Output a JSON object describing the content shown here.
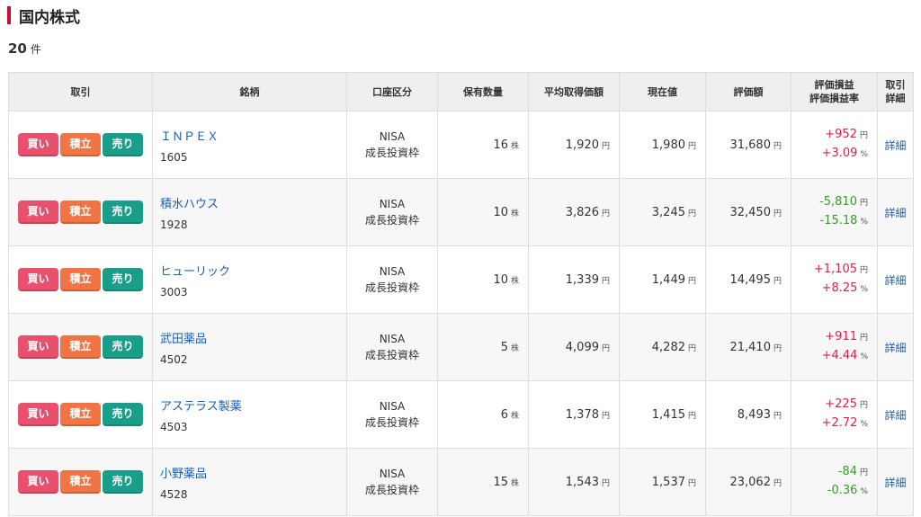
{
  "section": {
    "title": "国内株式"
  },
  "summary": {
    "count": "20",
    "unit": "件"
  },
  "headers": {
    "trade": "取引",
    "stock": "銘柄",
    "account": "口座区分",
    "quantity": "保有数量",
    "avg_cost": "平均取得価額",
    "price": "現在値",
    "value": "評価額",
    "pl_line1": "評価損益",
    "pl_line2": "評価損益率",
    "detail_line1": "取引",
    "detail_line2": "詳細"
  },
  "buttons": {
    "buy": "買い",
    "accumulate": "積立",
    "sell": "売り"
  },
  "units": {
    "share": "株",
    "yen": "円",
    "percent": "%"
  },
  "colors": {
    "buy": "#e8506e",
    "accumulate": "#f07444",
    "sell": "#1a9e8a",
    "gain": "#e0204a",
    "loss": "#3a9a2a",
    "title_accent": "#c8102e"
  },
  "rows": [
    {
      "name": "ＩＮＰＥＸ",
      "code": "1605",
      "account_line1": "NISA",
      "account_line2": "成長投資枠",
      "quantity": "16",
      "avg_cost": "1,920",
      "price": "1,980",
      "value": "31,680",
      "pl": "+952",
      "pl_rate": "+3.09",
      "positive": true,
      "detail": "詳細"
    },
    {
      "name": "積水ハウス",
      "code": "1928",
      "account_line1": "NISA",
      "account_line2": "成長投資枠",
      "quantity": "10",
      "avg_cost": "3,826",
      "price": "3,245",
      "value": "32,450",
      "pl": "-5,810",
      "pl_rate": "-15.18",
      "positive": false,
      "detail": "詳細"
    },
    {
      "name": "ヒューリック",
      "code": "3003",
      "account_line1": "NISA",
      "account_line2": "成長投資枠",
      "quantity": "10",
      "avg_cost": "1,339",
      "price": "1,449",
      "value": "14,495",
      "pl": "+1,105",
      "pl_rate": "+8.25",
      "positive": true,
      "detail": "詳細"
    },
    {
      "name": "武田薬品",
      "code": "4502",
      "account_line1": "NISA",
      "account_line2": "成長投資枠",
      "quantity": "5",
      "avg_cost": "4,099",
      "price": "4,282",
      "value": "21,410",
      "pl": "+911",
      "pl_rate": "+4.44",
      "positive": true,
      "detail": "詳細"
    },
    {
      "name": "アステラス製薬",
      "code": "4503",
      "account_line1": "NISA",
      "account_line2": "成長投資枠",
      "quantity": "6",
      "avg_cost": "1,378",
      "price": "1,415",
      "value": "8,493",
      "pl": "+225",
      "pl_rate": "+2.72",
      "positive": true,
      "detail": "詳細"
    },
    {
      "name": "小野薬品",
      "code": "4528",
      "account_line1": "NISA",
      "account_line2": "成長投資枠",
      "quantity": "15",
      "avg_cost": "1,543",
      "price": "1,537",
      "value": "23,062",
      "pl": "-84",
      "pl_rate": "-0.36",
      "positive": false,
      "detail": "詳細"
    }
  ]
}
